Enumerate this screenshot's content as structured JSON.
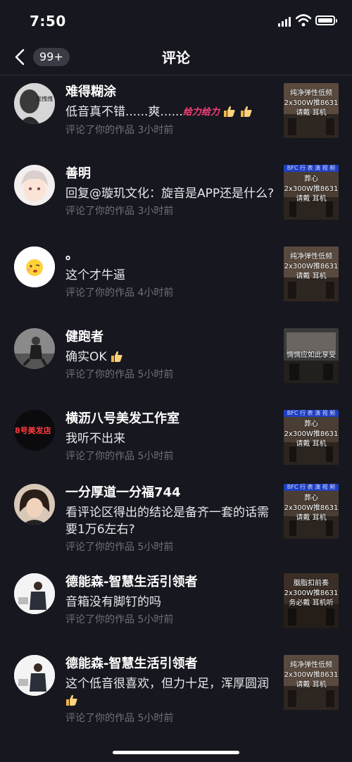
{
  "status_bar": {
    "time": "7:50"
  },
  "nav": {
    "badge": "99+",
    "title": "评论"
  },
  "thumb_texts": {
    "a_top": "纯净弹性低频",
    "a_mid": "2x300W推8631",
    "a_bot": "请戴  耳机",
    "b_top": "葬心",
    "b_mid": "2x300W推8631",
    "b_bot": "请戴  耳机",
    "c_top": "纯净弹性低频",
    "c_mid": "2x300W推8631",
    "c_bot": "请戴  耳机",
    "d_mid": "惆惆应如此享受",
    "e_top": "葬心",
    "e_mid": "2x300W推8631",
    "e_bot": "请戴  耳机",
    "f_top": "葬心",
    "f_mid": "2x300W推8631",
    "f_bot": "请戴  耳机",
    "g_top": "胭脂扣前奏",
    "g_mid": "2x300W推8631",
    "g_bot": "务必戴  耳机听",
    "h_top": "纯净弹性低频",
    "h_mid": "2x300W推8631",
    "h_bot": "请戴  耳机"
  },
  "items": [
    {
      "name": "难得糊涂",
      "comment": "低音真不错......爽......",
      "deco": "给力给力",
      "meta": "评论了你的作品   3小时前",
      "avatar_text": "我拽拽"
    },
    {
      "name": "善明",
      "comment": "回复@璇玑文化：旋音是APP还是什么?",
      "meta": "评论了你的作品   3小时前"
    },
    {
      "name": "。",
      "comment": "这个才牛逼",
      "meta": "评论了你的作品   4小时前"
    },
    {
      "name": "健跑者",
      "comment": "确实OK",
      "meta": "评论了你的作品   5小时前"
    },
    {
      "name": "横沥八号美发工作室",
      "comment": "我听不出来",
      "meta": "评论了你的作品   5小时前",
      "avatar_text": "8号美发店"
    },
    {
      "name": "一分厚道一分福744",
      "comment": "看评论区得出的结论是备齐一套的话需要1万6左右?",
      "meta": "评论了你的作品   5小时前"
    },
    {
      "name": "德能森-智慧生活引领者",
      "comment": "音箱没有脚钉的吗",
      "meta": "评论了你的作品   5小时前"
    },
    {
      "name": "德能森-智慧生活引领者",
      "comment": "这个低音很喜欢，但力十足，浑厚圆润",
      "meta": "评论了你的作品   5小时前"
    }
  ],
  "thumb_head": "BFC 行 表 演 视 频"
}
